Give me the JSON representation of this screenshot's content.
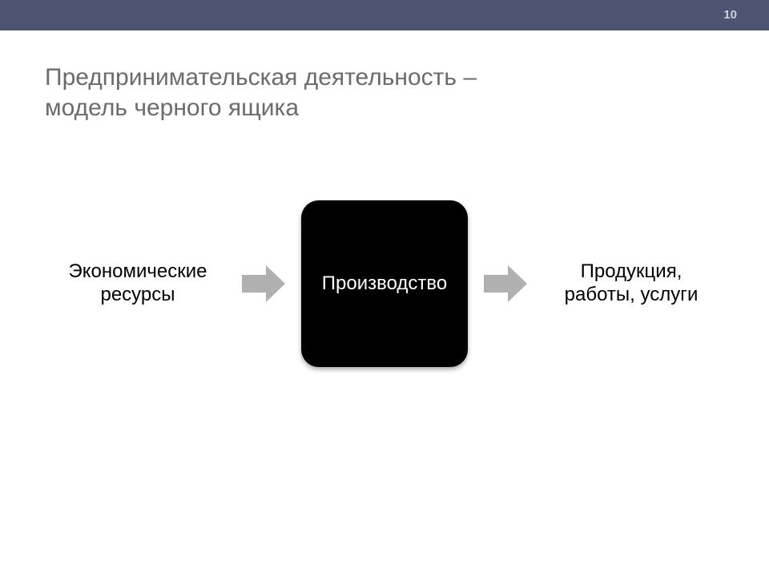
{
  "header": {
    "page_number": "10"
  },
  "title": {
    "line1": "Предпринимательская деятельность –",
    "line2": "модель черного ящика"
  },
  "diagram": {
    "input_label_line1": "Экономические",
    "input_label_line2": "ресурсы",
    "center_label": "Производство",
    "output_label_line1": "Продукция,",
    "output_label_line2": "работы, услуги",
    "arrow_color": "#b0b0b0"
  }
}
